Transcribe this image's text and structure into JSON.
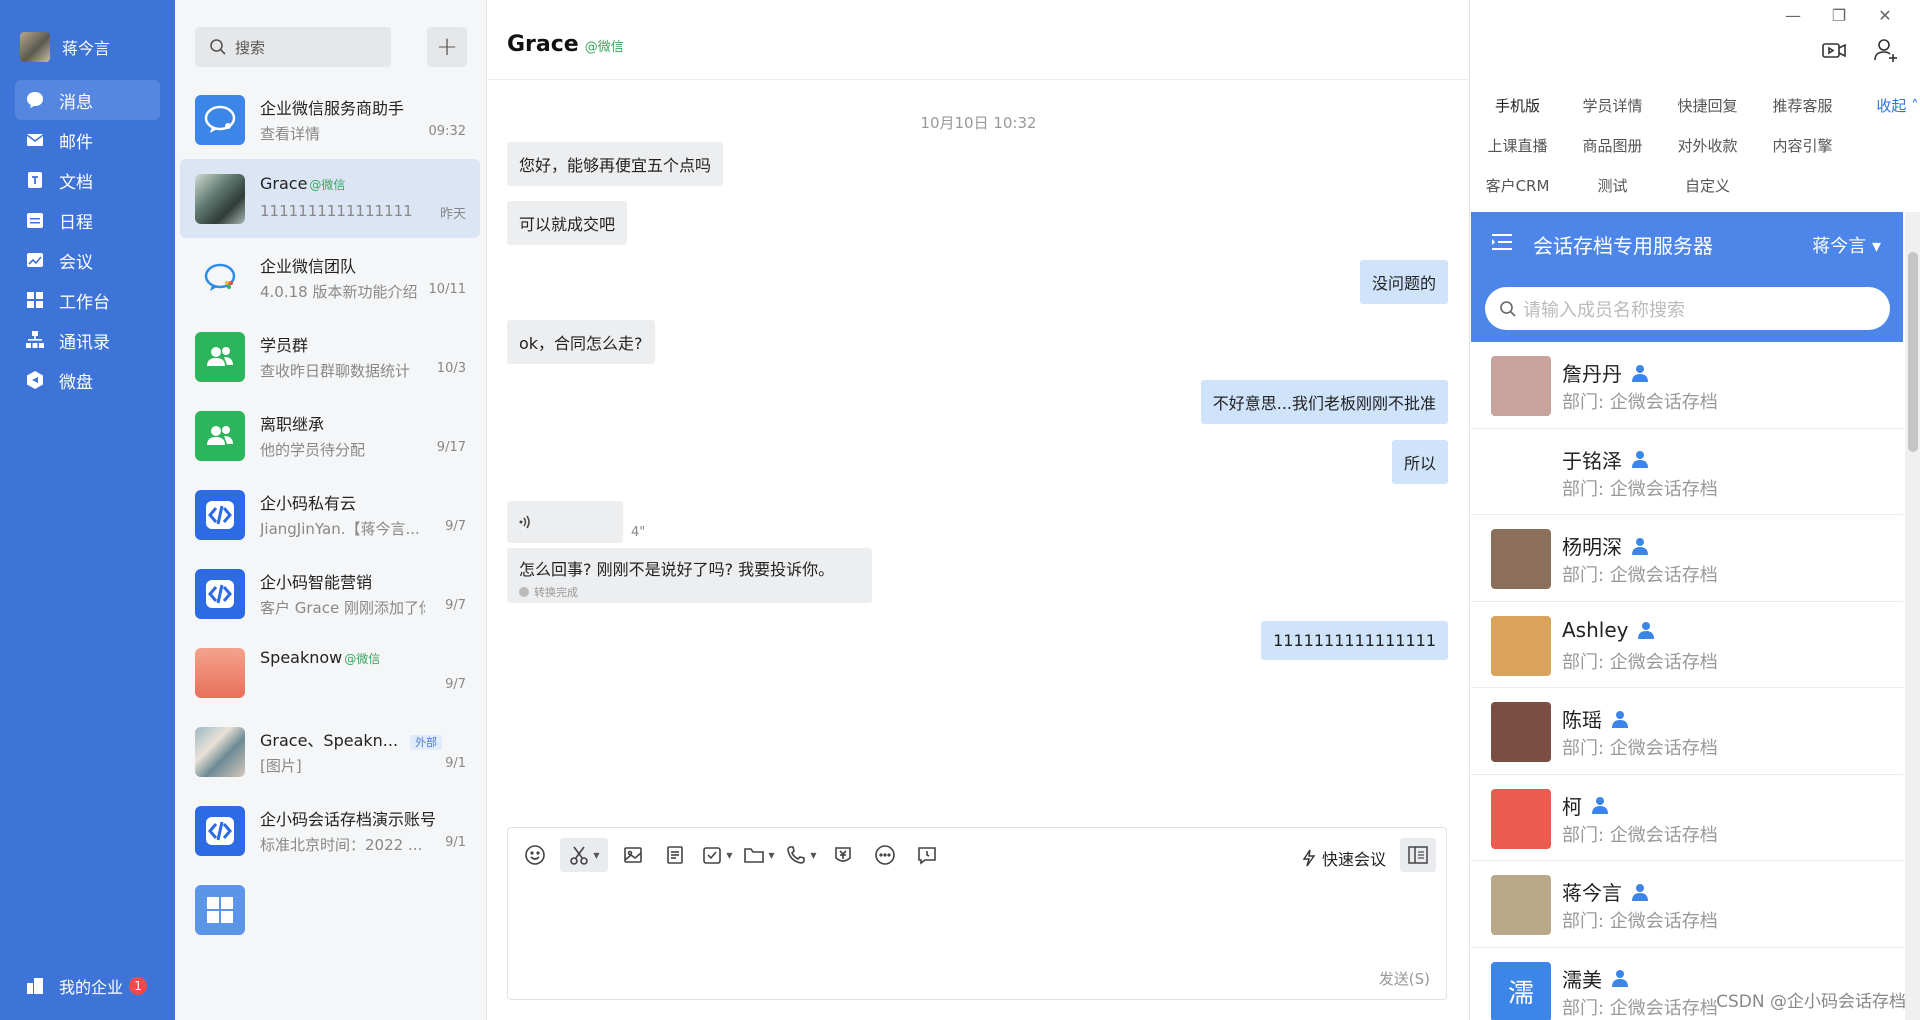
{
  "nav": {
    "user_name": "蒋今言",
    "items": [
      {
        "label": "消息",
        "icon": "message-icon",
        "active": true
      },
      {
        "label": "邮件",
        "icon": "mail-icon"
      },
      {
        "label": "文档",
        "icon": "document-icon"
      },
      {
        "label": "日程",
        "icon": "calendar-icon"
      },
      {
        "label": "会议",
        "icon": "meeting-icon"
      },
      {
        "label": "工作台",
        "icon": "workbench-icon"
      },
      {
        "label": "通讯录",
        "icon": "contacts-icon"
      },
      {
        "label": "微盘",
        "icon": "drive-icon"
      }
    ],
    "enterprise_label": "我的企业",
    "enterprise_badge": "1"
  },
  "conversations": {
    "search_placeholder": "搜索",
    "add_label": "+",
    "items": [
      {
        "name": "企业微信服务商助手",
        "sub": "查看详情",
        "time": "09:32",
        "avatar": "av-blue"
      },
      {
        "name": "Grace",
        "wx": "@微信",
        "sub": "1111111111111111",
        "time": "昨天",
        "avatar": "av-photo1",
        "active": true
      },
      {
        "name": "企业微信团队",
        "sub": "4.0.18 版本新功能介绍",
        "time": "10/11",
        "avatar": "av-white"
      },
      {
        "name": "学员群",
        "sub": "查收昨日群聊数据统计",
        "time": "10/3",
        "avatar": "av-green"
      },
      {
        "name": "离职继承",
        "sub": "他的学员待分配",
        "time": "9/17",
        "avatar": "av-green"
      },
      {
        "name": "企小码私有云",
        "sub": "JiangJinYan.【蒋今言...",
        "time": "9/7",
        "avatar": "av-code"
      },
      {
        "name": "企小码智能营销",
        "sub": "客户 Grace 刚刚添加了你",
        "time": "9/7",
        "avatar": "av-code"
      },
      {
        "name": "Speaknow",
        "wx": "@微信",
        "sub": "",
        "time": "9/7",
        "avatar": "av-peach"
      },
      {
        "name": "Grace、Speakn...",
        "ext": "外部",
        "sub": "[图片]",
        "time": "9/1",
        "avatar": "av-photo2"
      },
      {
        "name": "企小码会话存档演示账号",
        "sub": "标准北京时间：2022 ...",
        "time": "9/1",
        "avatar": "av-code"
      },
      {
        "name": "",
        "sub": "",
        "time": "",
        "avatar": "av-grid"
      }
    ]
  },
  "chat": {
    "title": "Grace",
    "title_wx": "@微信",
    "timestamp": "10月10日 10:32",
    "messages": [
      {
        "side": "l",
        "text": "您好，能够再便宜五个点吗"
      },
      {
        "side": "l",
        "text": "可以就成交吧"
      },
      {
        "side": "r",
        "text": "没问题的"
      },
      {
        "side": "l",
        "text": "ok，合同怎么走?"
      },
      {
        "side": "r",
        "text": "不好意思...我们老板刚刚不批准"
      },
      {
        "side": "r",
        "text": "所以"
      },
      {
        "side": "r",
        "text": "1111111111111111"
      }
    ],
    "voice_duration": "4\"",
    "voice_transcript": "怎么回事? 刚刚不是说好了吗? 我要投诉你。",
    "voice_status": "转换完成",
    "quick_meeting": "快速会议",
    "send_label": "发送(S)"
  },
  "right": {
    "window_controls": [
      "—",
      "❐",
      "✕"
    ],
    "apps": [
      {
        "label": "手机版",
        "active": true
      },
      {
        "label": "学员详情"
      },
      {
        "label": "快捷回复"
      },
      {
        "label": "推荐客服"
      },
      {
        "label": "收起 ˄",
        "fold": true
      },
      {
        "label": "上课直播"
      },
      {
        "label": "商品图册"
      },
      {
        "label": "对外收款"
      },
      {
        "label": "内容引擎"
      },
      {
        "label": ""
      },
      {
        "label": "客户CRM"
      },
      {
        "label": "测试"
      },
      {
        "label": "自定义"
      }
    ],
    "crm": {
      "title": "会话存档专用服务器",
      "user": "蒋今言 ▾",
      "search_placeholder": "请输入成员名称搜索"
    },
    "members": [
      {
        "name": "詹丹丹",
        "dept": "部门: 企微会话存档",
        "color": "#c7a39b"
      },
      {
        "name": "于铭泽",
        "dept": "部门: 企微会话存档",
        "color": "#ffffff"
      },
      {
        "name": "杨明深",
        "dept": "部门: 企微会话存档",
        "color": "#8b6f5a"
      },
      {
        "name": "Ashley",
        "dept": "部门: 企微会话存档",
        "color": "#d9a35c"
      },
      {
        "name": "陈瑶",
        "dept": "部门: 企微会话存档",
        "color": "#7a4e42"
      },
      {
        "name": "柯",
        "dept": "部门: 企微会话存档",
        "color": "#ec5a50"
      },
      {
        "name": "蒋今言",
        "dept": "部门: 企微会话存档",
        "color": "#b9a88a"
      },
      {
        "name": "濡美",
        "dept": "部门: 企微会话存档",
        "color": "#3c86e8",
        "initial": "濡"
      }
    ],
    "watermark": "CSDN @企小码会话存档"
  }
}
